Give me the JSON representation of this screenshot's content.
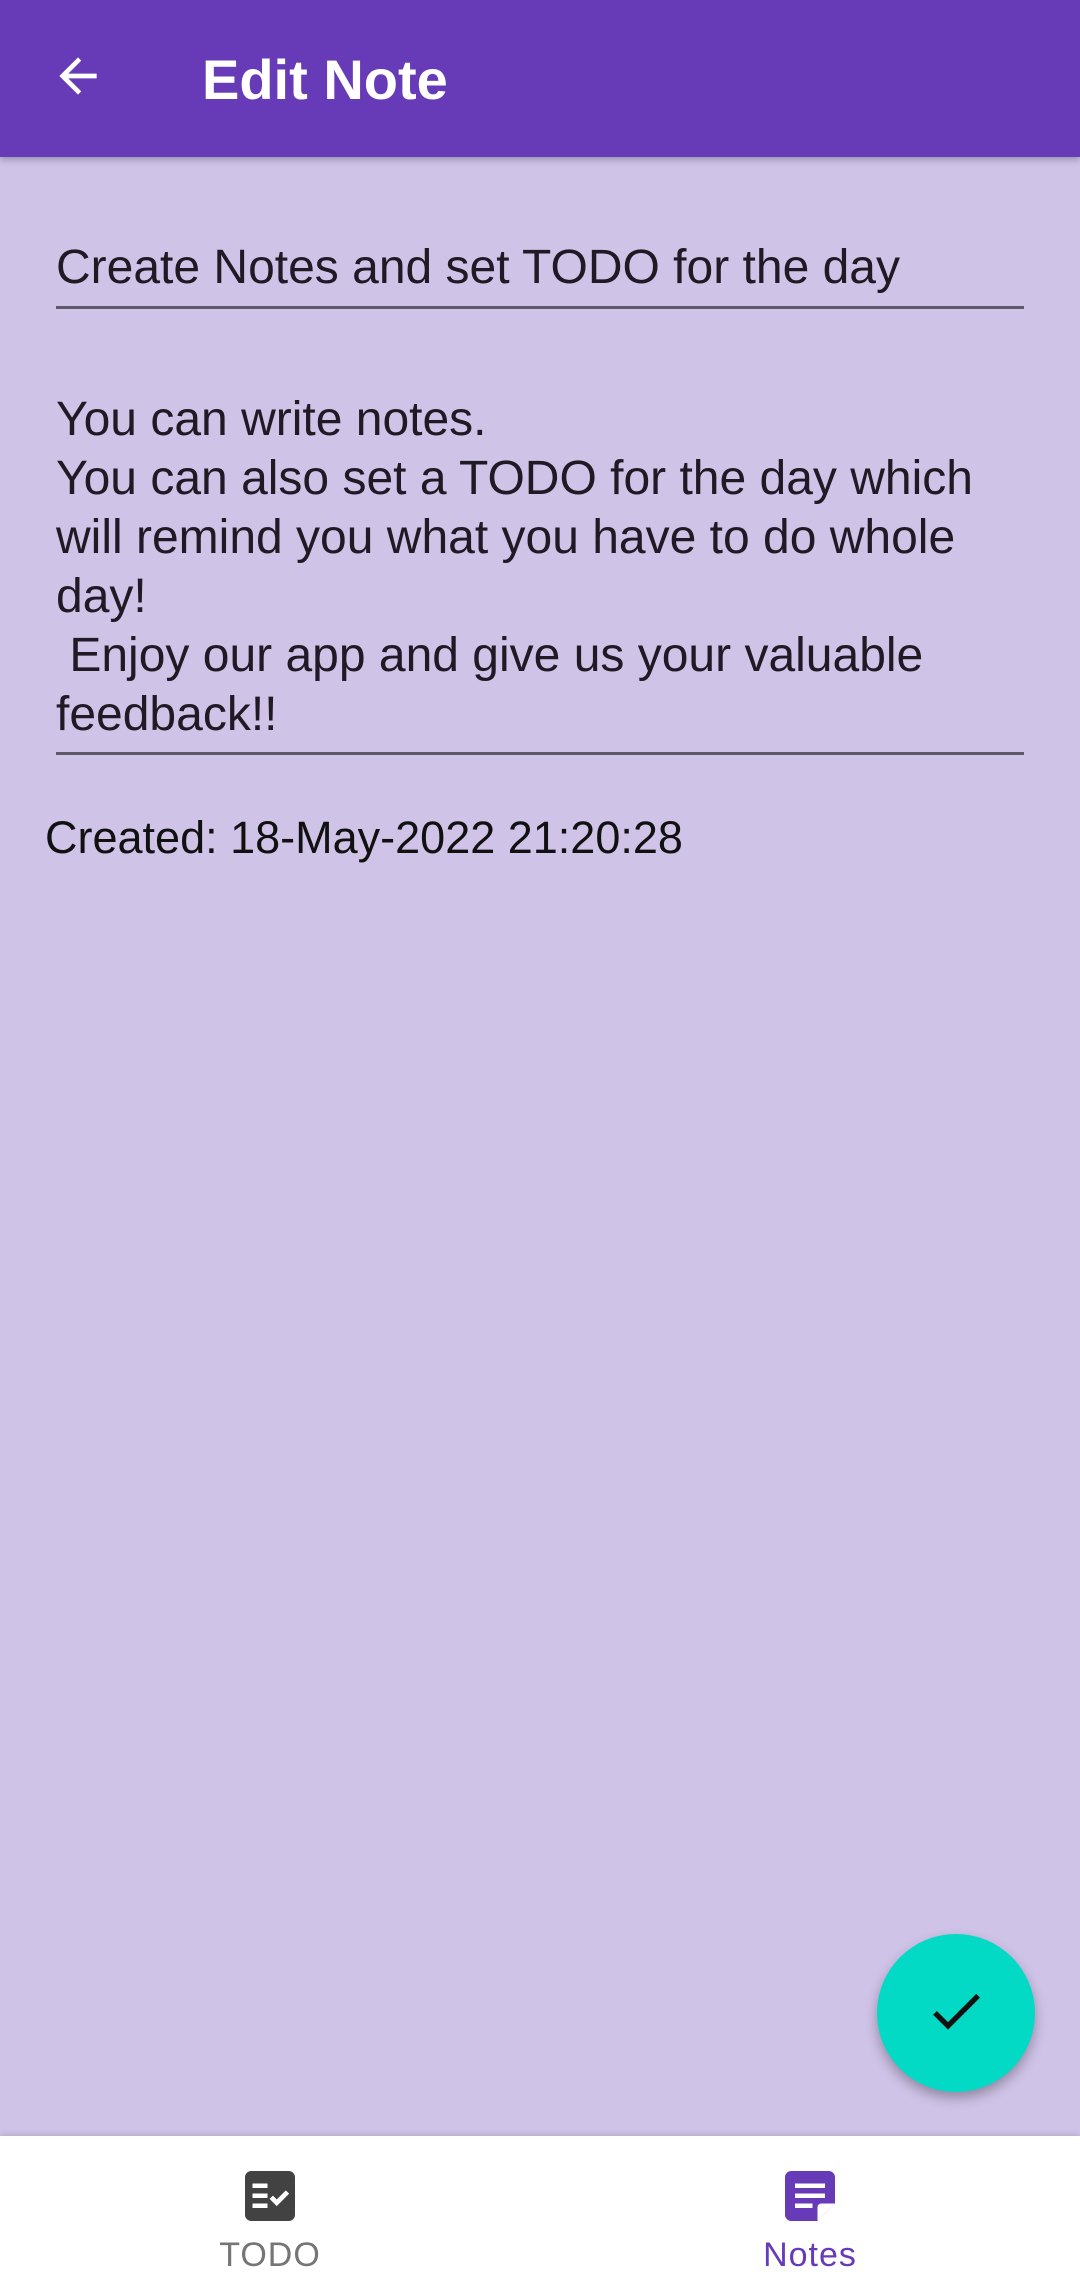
{
  "app_bar": {
    "title": "Edit Note",
    "back_icon": "arrow-back-icon",
    "background_color": "#673ab7"
  },
  "note": {
    "title_value": "Create Notes and set TODO for the day",
    "body_value": "You can write notes.\nYou can also set a TODO for the day which will remind you what you have to do whole day!\n Enjoy our app and give us your valuable feedback!!",
    "created_label": "Created: 18-May-2022 21:20:28"
  },
  "fab": {
    "icon": "check-icon",
    "color": "#03dac5"
  },
  "bottom_nav": {
    "items": [
      {
        "label": "TODO",
        "icon": "checklist-icon",
        "selected": false
      },
      {
        "label": "Notes",
        "icon": "note-icon",
        "selected": true
      }
    ],
    "active_color": "#673ab7",
    "inactive_color": "#757575"
  },
  "colors": {
    "screen_background": "#cfc3e8"
  }
}
